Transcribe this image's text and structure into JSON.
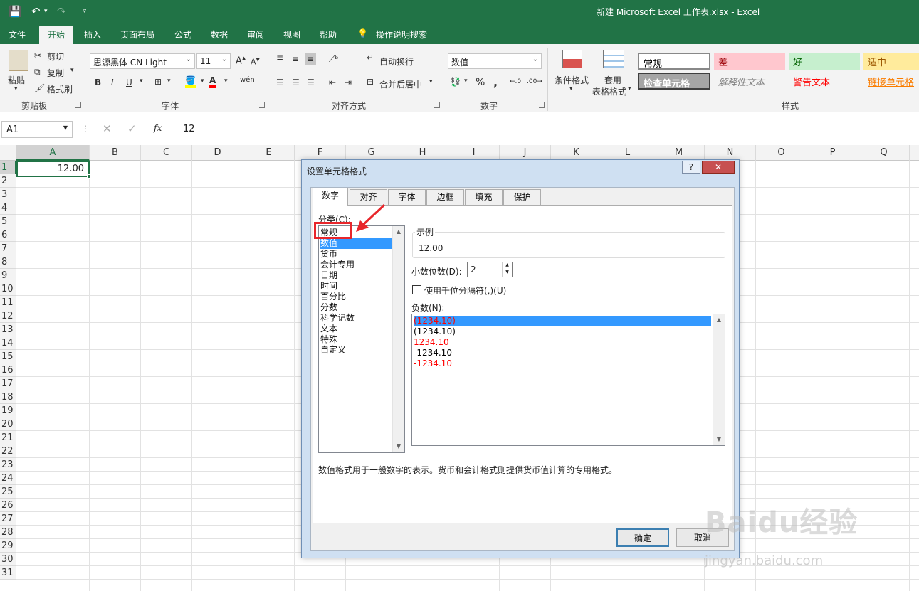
{
  "window": {
    "title": "新建 Microsoft Excel 工作表.xlsx  -  Excel"
  },
  "ribbon_tabs": [
    "文件",
    "开始",
    "插入",
    "页面布局",
    "公式",
    "数据",
    "审阅",
    "视图",
    "帮助",
    "操作说明搜索"
  ],
  "ribbon": {
    "clipboard": {
      "paste": "粘贴",
      "cut": "剪切",
      "copy": "复制",
      "format_painter": "格式刷",
      "label": "剪贴板"
    },
    "font": {
      "name": "思源黑体 CN Light",
      "size": "11",
      "bold": "B",
      "italic": "I",
      "underline": "U",
      "label": "字体"
    },
    "alignment": {
      "wrap": "自动换行",
      "merge": "合并后居中",
      "label": "对齐方式"
    },
    "number": {
      "format": "数值",
      "percent": "%",
      "comma": ",",
      "label": "数字"
    },
    "styles_btns": {
      "conditional": "条件格式",
      "table_line1": "套用",
      "table_line2": "表格格式",
      "label": "样式"
    },
    "cell_styles": [
      {
        "text": "常规",
        "bg": "#ffffff",
        "color": "#000000"
      },
      {
        "text": "差",
        "bg": "#ffc7ce",
        "color": "#9c0006"
      },
      {
        "text": "好",
        "bg": "#c6efce",
        "color": "#006100"
      },
      {
        "text": "适中",
        "bg": "#ffeb9c",
        "color": "#9c5700"
      },
      {
        "text": "检查单元格",
        "bg": "#a5a5a5",
        "color": "#ffffff"
      },
      {
        "text": "解释性文本",
        "bg": "#f3f3f3",
        "color": "#7f7f7f"
      },
      {
        "text": "警告文本",
        "bg": "#f3f3f3",
        "color": "#ff0000"
      },
      {
        "text": "链接单元格",
        "bg": "#f3f3f3",
        "color": "#fa7d00"
      }
    ]
  },
  "formula_bar": {
    "name_box": "A1",
    "fx": "fx",
    "content": "12"
  },
  "columns": [
    "A",
    "B",
    "C",
    "D",
    "E",
    "F",
    "G",
    "H",
    "I",
    "J",
    "K",
    "L",
    "M",
    "N",
    "O",
    "P",
    "Q"
  ],
  "rows": [
    "1",
    "2",
    "3",
    "4",
    "5",
    "6",
    "7",
    "8",
    "9",
    "10",
    "11",
    "12",
    "13",
    "14",
    "15",
    "16",
    "17",
    "18",
    "19",
    "20",
    "21",
    "22",
    "23",
    "24",
    "25",
    "26",
    "27",
    "28",
    "29",
    "30",
    "31"
  ],
  "cells": {
    "A1": "12.00"
  },
  "dialog": {
    "title": "设置单元格格式",
    "help": "?",
    "close": "✕",
    "tabs": [
      "数字",
      "对齐",
      "字体",
      "边框",
      "填充",
      "保护"
    ],
    "category_label": "分类(C):",
    "categories": [
      "常规",
      "数值",
      "货币",
      "会计专用",
      "日期",
      "时间",
      "百分比",
      "分数",
      "科学记数",
      "文本",
      "特殊",
      "自定义"
    ],
    "sample_label": "示例",
    "sample_value": "12.00",
    "decimal_label": "小数位数(D):",
    "decimal_value": "2",
    "thousands_label": "使用千位分隔符(,)(U)",
    "negative_label": "负数(N):",
    "negatives": [
      {
        "text": "(1234.10)",
        "color": "#ff0000"
      },
      {
        "text": "(1234.10)",
        "color": "#000000"
      },
      {
        "text": "1234.10",
        "color": "#ff0000"
      },
      {
        "text": "-1234.10",
        "color": "#000000"
      },
      {
        "text": "-1234.10",
        "color": "#ff0000"
      }
    ],
    "description": "数值格式用于一般数字的表示。货币和会计格式则提供货币值计算的专用格式。",
    "ok": "确定",
    "cancel": "取消"
  },
  "watermark": {
    "text": "Baidu经验",
    "url": "jingyan.baidu.com"
  },
  "colors": {
    "excel_green": "#217346",
    "highlight": "#3399ff",
    "annotation_red": "#e8262b"
  }
}
